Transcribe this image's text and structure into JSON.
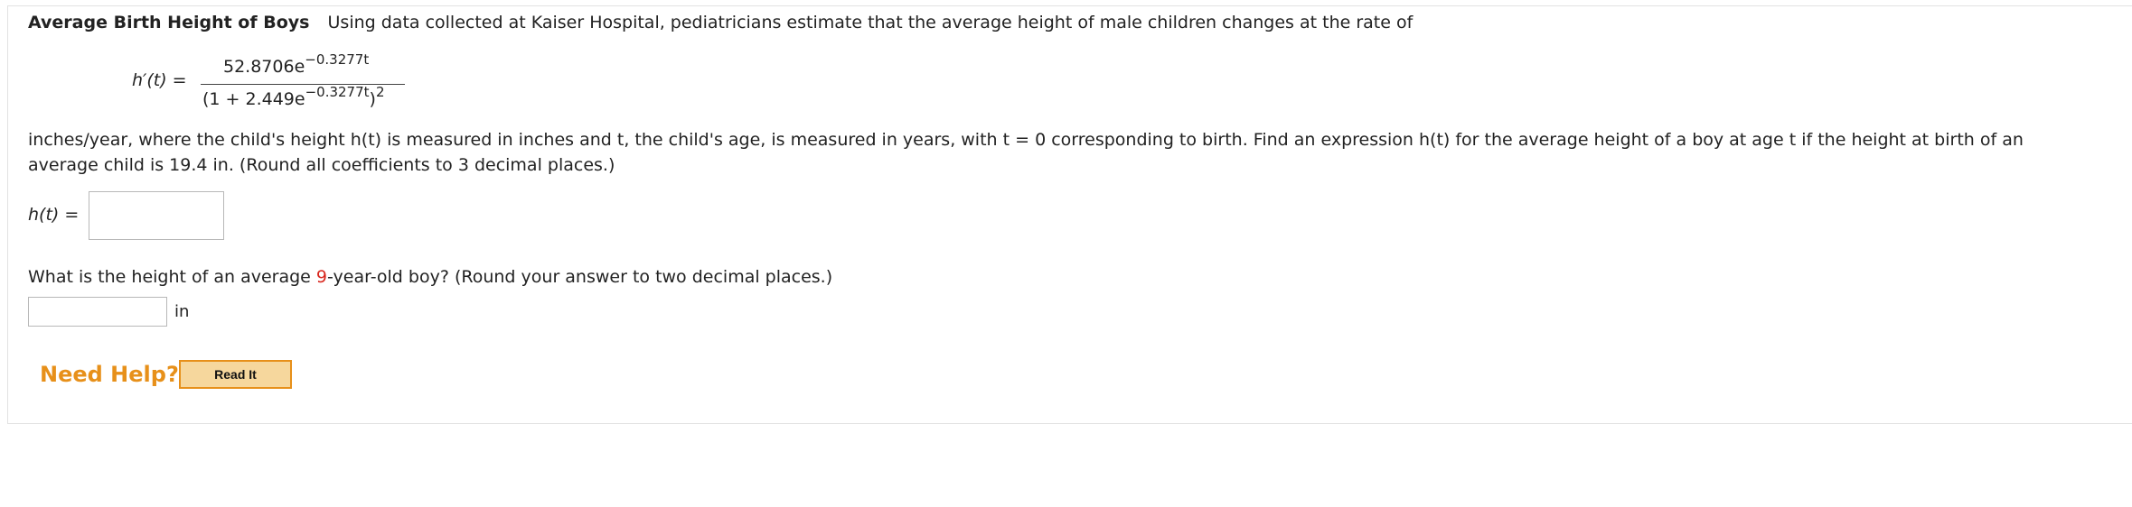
{
  "problem": {
    "title": "Average Birth Height of Boys",
    "intro": "Using data collected at Kaiser Hospital, pediatricians estimate that the average height of male children changes at the rate of",
    "formula": {
      "lhs": "h′(t) =",
      "numerator_base": "52.8706e",
      "numerator_exp": "−0.3277t",
      "denominator_base": "(1 + 2.449e",
      "denominator_exp": "−0.3277t",
      "denominator_close": ")",
      "denominator_power": "2"
    },
    "body_line1": "inches/year, where the child's height h(t) is measured in inches and t, the child's age, is measured in years, with t = 0 corresponding to birth. Find an expression h(t) for the average height of a boy at age t if the height at birth of an",
    "body_line2": "average child is 19.4 in. (Round all coefficients to 3 decimal places.)",
    "answer1_label": "h(t) =",
    "answer1_value": "",
    "question2_before": "What is the height of an average ",
    "question2_highlight": "9",
    "question2_after": "-year-old boy? (Round your answer to two decimal places.)",
    "answer2_value": "",
    "answer2_unit": "in"
  },
  "help": {
    "label": "Need Help?",
    "button": "Read It"
  },
  "colors": {
    "accent": "#e7901a",
    "highlight": "#d8261d",
    "button_bg": "#f6d79d"
  }
}
